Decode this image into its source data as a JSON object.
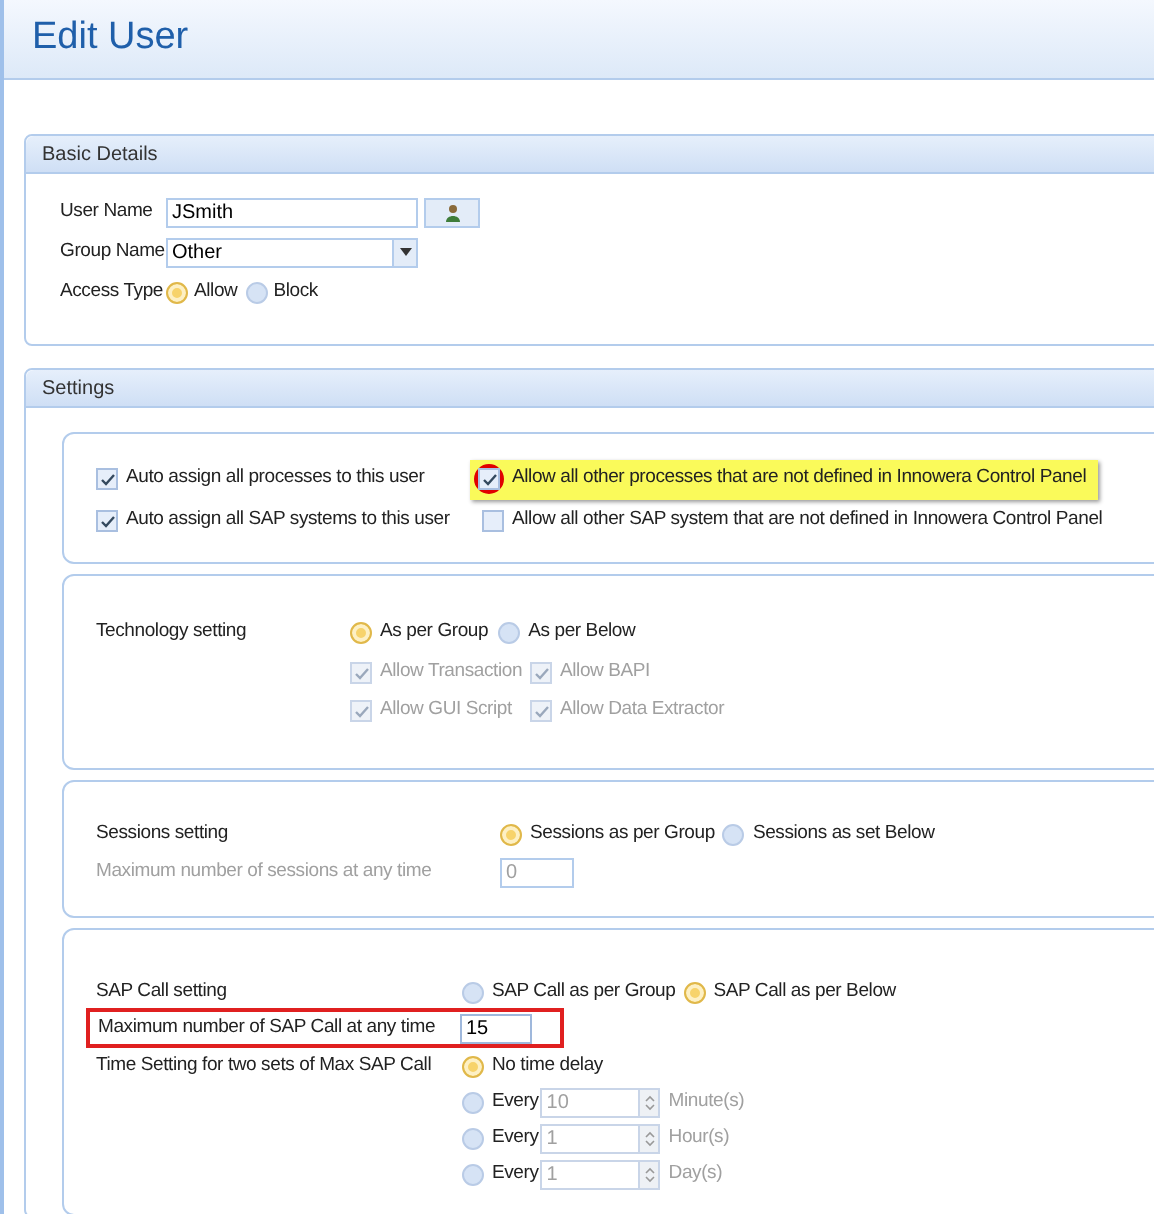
{
  "window": {
    "title": "Edit User"
  },
  "basic_details": {
    "title": "Basic Details",
    "user_name": {
      "label": "User Name",
      "value": "JSmith"
    },
    "group_name": {
      "label": "Group Name",
      "value": "Other"
    },
    "access_type": {
      "label": "Access Type",
      "options": [
        {
          "label": "Allow",
          "selected": true
        },
        {
          "label": "Block",
          "selected": false
        }
      ]
    }
  },
  "settings": {
    "title": "Settings",
    "assign_options": [
      {
        "label": "Auto assign all processes to this user",
        "checked": true,
        "highlighted": false
      },
      {
        "label": "Allow all other processes that are not defined in Innowera Control Panel",
        "checked": true,
        "highlighted": true
      },
      {
        "label": "Auto assign all SAP systems to this user",
        "checked": true,
        "highlighted": false
      },
      {
        "label": "Allow all other SAP system that are not defined in Innowera Control Panel",
        "checked": false,
        "highlighted": false
      }
    ],
    "technology": {
      "label": "Technology setting",
      "options": [
        {
          "label": "As per Group",
          "selected": true
        },
        {
          "label": "As per Below",
          "selected": false
        }
      ],
      "permissions": [
        {
          "label": "Allow Transaction",
          "checked": true,
          "disabled": true
        },
        {
          "label": "Allow BAPI",
          "checked": true,
          "disabled": true
        },
        {
          "label": "Allow GUI Script",
          "checked": true,
          "disabled": true
        },
        {
          "label": "Allow Data Extractor",
          "checked": true,
          "disabled": true
        }
      ]
    },
    "sessions": {
      "label": "Sessions setting",
      "options": [
        {
          "label": "Sessions as per Group",
          "selected": true
        },
        {
          "label": "Sessions as set Below",
          "selected": false
        }
      ],
      "max_label": "Maximum number of sessions at any time",
      "max_value": "0",
      "disabled": true
    },
    "sap_call": {
      "label": "SAP Call setting",
      "options": [
        {
          "label": "SAP Call as per Group",
          "selected": false
        },
        {
          "label": "SAP Call as per Below",
          "selected": true
        }
      ],
      "max_label": "Maximum number of SAP Call at any time",
      "max_value": "15",
      "max_highlighted": true,
      "time_label": "Time Setting for two sets of Max SAP Call",
      "time_options": [
        {
          "kind": "plain",
          "label": "No time delay",
          "selected": true
        },
        {
          "kind": "interval",
          "label": "Every",
          "value": "10",
          "unit": "Minute(s)",
          "selected": false,
          "disabled": true
        },
        {
          "kind": "interval",
          "label": "Every",
          "value": "1",
          "unit": "Hour(s)",
          "selected": false,
          "disabled": true
        },
        {
          "kind": "interval",
          "label": "Every",
          "value": "1",
          "unit": "Day(s)",
          "selected": false,
          "disabled": true
        }
      ]
    }
  }
}
